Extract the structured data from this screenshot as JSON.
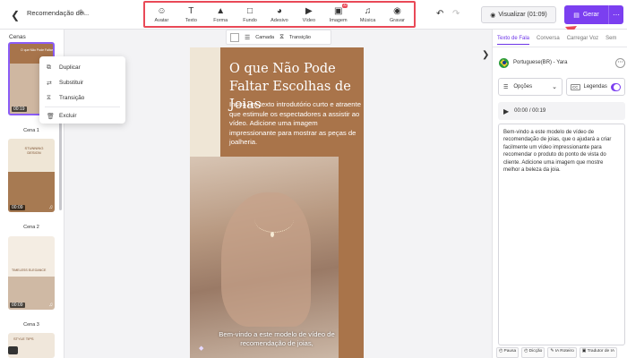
{
  "header": {
    "project_title": "Recomendação de...",
    "tools": [
      {
        "icon": "avatar-icon",
        "label": "Avatar"
      },
      {
        "icon": "text-icon",
        "label": "Texto"
      },
      {
        "icon": "shape-icon",
        "label": "Forma"
      },
      {
        "icon": "background-icon",
        "label": "Fundo"
      },
      {
        "icon": "sticker-icon",
        "label": "Adesivo"
      },
      {
        "icon": "video-icon",
        "label": "Vídeo"
      },
      {
        "icon": "image-icon",
        "label": "Imagem",
        "badge": "AI"
      },
      {
        "icon": "music-icon",
        "label": "Música"
      },
      {
        "icon": "record-icon",
        "label": "Gravar"
      }
    ],
    "preview_label": "Visualizar (01:09)",
    "generate_label": "Gerar",
    "accent": "#7b3ff0",
    "highlight": "#e94957"
  },
  "left": {
    "title": "Cenas",
    "scenes": [
      {
        "name": "Cena 1",
        "time": "00:19"
      },
      {
        "name": "Cena 2",
        "time": "00:09"
      },
      {
        "name": "Cena 3",
        "time": "00:09"
      }
    ],
    "thumb_texts": {
      "t1": "O que Não Pode Faltar",
      "t2": "STUNNING DESIGN",
      "t3": "TIMELESS ELEGANCE",
      "t4": "STYLE TIPS"
    }
  },
  "context_menu": {
    "items": [
      "Duplicar",
      "Substituir",
      "Transição",
      "Excluir"
    ]
  },
  "canvas_toolbar": {
    "layer_label": "Camada",
    "transition_label": "Transição"
  },
  "canvas": {
    "heading": "O que Não Pode Faltar Escolhas de Joias",
    "intro": "Insira um texto introdutório curto e atraente que estimule os espectadores a assistir ao vídeo. Adicione uma imagem impressionante para mostrar as peças de joalheria.",
    "caption": "Bem-vindo a este modelo de vídeo de recomendação de joias,",
    "bg_color": "#a9744a"
  },
  "right": {
    "tabs": [
      "Texto de Fala",
      "Conversa",
      "Carregar Voz",
      "Sem"
    ],
    "voice": "Portuguese(BR) - Yara",
    "options_label": "Opções",
    "legend_label": "Legendas",
    "legend_on": true,
    "player_time": "00:00 / 00:19",
    "script": "Bem-vindo a este modelo de vídeo de recomendação de joias, que o ajudará a criar facilmente um vídeo impressionante para recomendar o produto do ponto de vista do cliente. Adicione uma imagem que mostre melhor a beleza da joia.",
    "bottom_tools": [
      "Pausa",
      "Dicção",
      "IA Roteiro",
      "Tradutor de IA"
    ]
  }
}
